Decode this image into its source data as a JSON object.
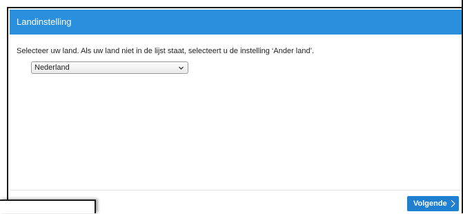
{
  "dialog": {
    "title": "Landinstelling",
    "instruction": "Selecteer uw land. Als uw land niet in de lijst staat, selecteert u de instelling ‘Ander land’.",
    "country_select": {
      "selected": "Nederland"
    },
    "footer": {
      "next_label": "Volgende"
    }
  },
  "colors": {
    "titlebar": "#2a8fdc",
    "primary_button": "#1f7fd1"
  },
  "icons": {
    "select_arrow": "chevron-down-icon",
    "next_arrow": "chevron-right-icon"
  }
}
